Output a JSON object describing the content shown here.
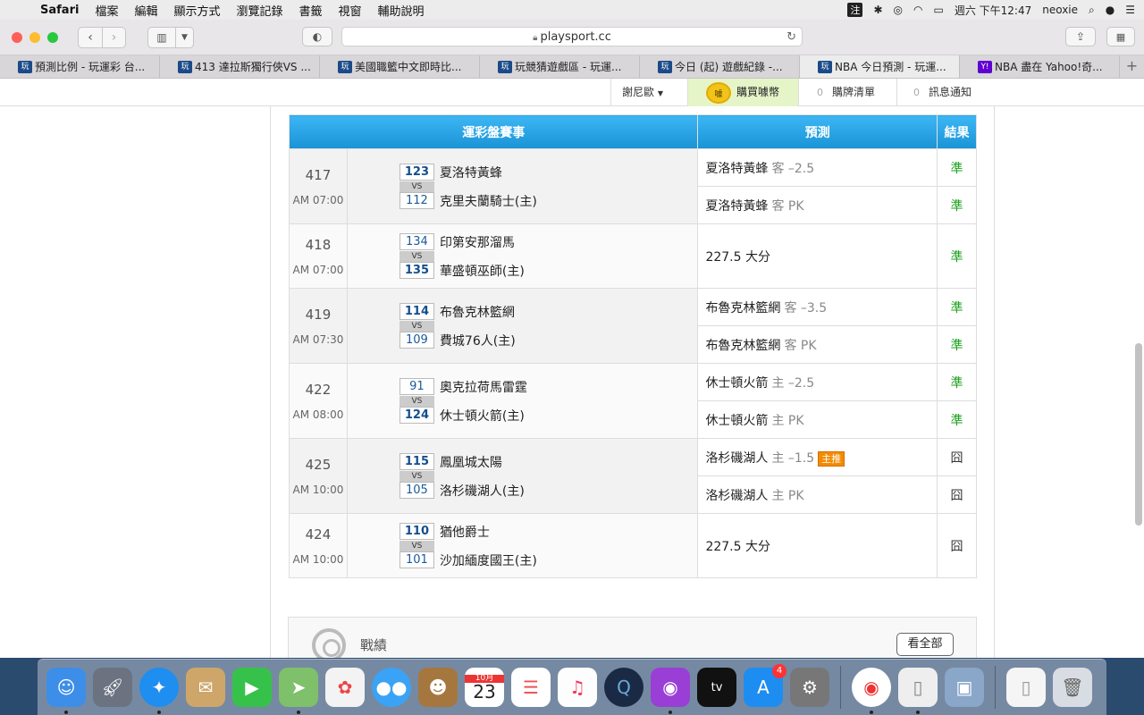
{
  "menubar": {
    "app": "Safari",
    "items": [
      "檔案",
      "編輯",
      "顯示方式",
      "瀏覽記錄",
      "書籤",
      "視窗",
      "輔助說明"
    ],
    "ime": "注",
    "clock": "週六 下午12:47",
    "user": "neoxie"
  },
  "browser": {
    "url": "playsport.cc",
    "tabs": [
      {
        "label": "預測比例 - 玩運彩 台...",
        "favicon": "玩"
      },
      {
        "label": "413 達拉斯獨行俠VS ...",
        "favicon": "玩"
      },
      {
        "label": "美國職籃中文即時比...",
        "favicon": "玩"
      },
      {
        "label": "玩競猜遊戲區 - 玩運...",
        "favicon": "玩"
      },
      {
        "label": "今日 (起) 遊戲紀錄 -...",
        "favicon": "玩"
      },
      {
        "label": "NBA 今日預測 - 玩運...",
        "favicon": "玩",
        "active": true
      },
      {
        "label": "NBA 盡在 Yahoo!奇...",
        "favicon": "Y!"
      }
    ]
  },
  "topnav": {
    "user": "謝尼歐",
    "buy_label": "購買噱幣",
    "coin_label": "噱",
    "cart_count": "0",
    "cart_label": "購牌清單",
    "notify_count": "0",
    "notify_label": "訊息通知"
  },
  "table": {
    "headers": {
      "event": "運彩盤賽事",
      "prediction": "預測",
      "result": "結果"
    },
    "vs_label": "VS",
    "games": [
      {
        "no": "417",
        "time": "AM 07:00",
        "away": {
          "score": "123",
          "name": "夏洛特黃蜂",
          "win": true
        },
        "home": {
          "score": "112",
          "name": "克里夫蘭騎士(主)",
          "win": false
        },
        "predictions": [
          {
            "team": "夏洛特黃蜂",
            "side": "客 –2.5",
            "result": "準",
            "correct": true
          },
          {
            "team": "夏洛特黃蜂",
            "side": "客 PK",
            "result": "準",
            "correct": true
          }
        ]
      },
      {
        "no": "418",
        "time": "AM 07:00",
        "away": {
          "score": "134",
          "name": "印第安那溜馬",
          "win": false
        },
        "home": {
          "score": "135",
          "name": "華盛頓巫師(主)",
          "win": true
        },
        "predictions": [
          {
            "team": "227.5 大分",
            "side": "",
            "result": "準",
            "correct": true
          }
        ]
      },
      {
        "no": "419",
        "time": "AM 07:30",
        "away": {
          "score": "114",
          "name": "布魯克林籃網",
          "win": true
        },
        "home": {
          "score": "109",
          "name": "費城76人(主)",
          "win": false
        },
        "predictions": [
          {
            "team": "布魯克林籃網",
            "side": "客 –3.5",
            "result": "準",
            "correct": true
          },
          {
            "team": "布魯克林籃網",
            "side": "客 PK",
            "result": "準",
            "correct": true
          }
        ]
      },
      {
        "no": "422",
        "time": "AM 08:00",
        "away": {
          "score": "91",
          "name": "奧克拉荷馬雷霆",
          "win": false
        },
        "home": {
          "score": "124",
          "name": "休士頓火箭(主)",
          "win": true
        },
        "predictions": [
          {
            "team": "休士頓火箭",
            "side": "主 –2.5",
            "result": "準",
            "correct": true
          },
          {
            "team": "休士頓火箭",
            "side": "主 PK",
            "result": "準",
            "correct": true
          }
        ]
      },
      {
        "no": "425",
        "time": "AM 10:00",
        "away": {
          "score": "115",
          "name": "鳳凰城太陽",
          "win": true
        },
        "home": {
          "score": "105",
          "name": "洛杉磯湖人(主)",
          "win": false
        },
        "predictions": [
          {
            "team": "洛杉磯湖人",
            "side": "主 –1.5",
            "badge": "主推",
            "result": "囧",
            "correct": false
          },
          {
            "team": "洛杉磯湖人",
            "side": "主 PK",
            "result": "囧",
            "correct": false
          }
        ]
      },
      {
        "no": "424",
        "time": "AM 10:00",
        "away": {
          "score": "110",
          "name": "猶他爵士",
          "win": true
        },
        "home": {
          "score": "101",
          "name": "沙加緬度國王(主)",
          "win": false
        },
        "predictions": [
          {
            "team": "227.5 大分",
            "side": "",
            "result": "囧",
            "correct": false
          }
        ]
      }
    ]
  },
  "record": {
    "title": "戰績",
    "view_all": "看全部"
  },
  "dock": {
    "calendar_month": "10月",
    "calendar_day": "23",
    "appstore_badge": "4"
  },
  "colors": {
    "header_blue": "#2aa6e8",
    "win_green": "#1aa01a",
    "badge_orange": "#f28b00"
  }
}
